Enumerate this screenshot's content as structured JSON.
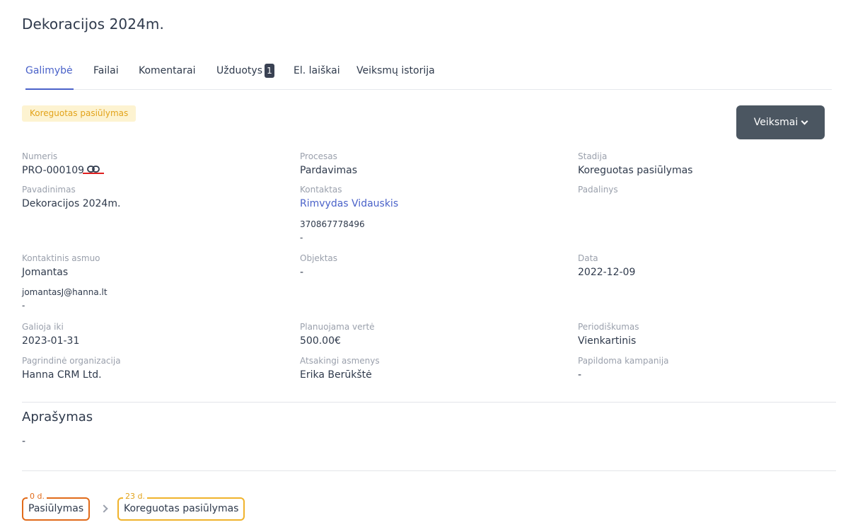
{
  "page": {
    "title": "Dekoracijos 2024m."
  },
  "tabs": [
    {
      "label": "Galimybė",
      "active": true
    },
    {
      "label": "Failai"
    },
    {
      "label": "Komentarai"
    },
    {
      "label": "Užduotys",
      "badge": "1"
    },
    {
      "label": "El. laiškai"
    },
    {
      "label": "Veiksmų istorija"
    }
  ],
  "stage_chip": "Koreguotas pasiūlymas",
  "actions_button": {
    "label": "Veiksmai",
    "icon": "chevron-down-icon"
  },
  "fields": {
    "numeris": {
      "label": "Numeris",
      "value": "PRO-000109",
      "icon": "link-icon"
    },
    "procesas": {
      "label": "Procesas",
      "value": "Pardavimas"
    },
    "stadija": {
      "label": "Stadija",
      "value": "Koreguotas pasiūlymas"
    },
    "pavadinimas": {
      "label": "Pavadinimas",
      "value": "Dekoracijos 2024m."
    },
    "kontaktas": {
      "label": "Kontaktas",
      "value": "Rimvydas Vidauskis",
      "phone": "370867778496",
      "extra": "-"
    },
    "padalinys": {
      "label": "Padalinys",
      "value": ""
    },
    "kontaktinis_asmuo": {
      "label": "Kontaktinis asmuo",
      "value": "Jomantas",
      "email": "jomantasJ@hanna.lt",
      "extra": "-"
    },
    "objektas": {
      "label": "Objektas",
      "value": "-"
    },
    "data": {
      "label": "Data",
      "value": "2022-12-09"
    },
    "galioja_iki": {
      "label": "Galioja iki",
      "value": "2023-01-31"
    },
    "planuojama_verte": {
      "label": "Planuojama vertė",
      "value": "500.00€"
    },
    "periodiskumas": {
      "label": "Periodiškumas",
      "value": "Vienkartinis"
    },
    "pagrindine_organizacija": {
      "label": "Pagrindinė organizacija",
      "value": "Hanna CRM Ltd."
    },
    "atsakingi_asmenys": {
      "label": "Atsakingi asmenys",
      "value": "Erika Berūkštė"
    },
    "papildoma_kampanija": {
      "label": "Papildoma kampanija",
      "value": "-"
    }
  },
  "description": {
    "title": "Aprašymas",
    "value": "-"
  },
  "stages": [
    {
      "days": "0 d.",
      "label": "Pasiūlymas",
      "color": "#e16b1a"
    },
    {
      "days": "23 d.",
      "label": "Koreguotas pasiūlymas",
      "color": "#f0b32c"
    }
  ],
  "colors": {
    "accent": "#4a62c9",
    "button": "#4b5661",
    "chip_bg": "#fdf3d1",
    "chip_text": "#e2a31a"
  }
}
